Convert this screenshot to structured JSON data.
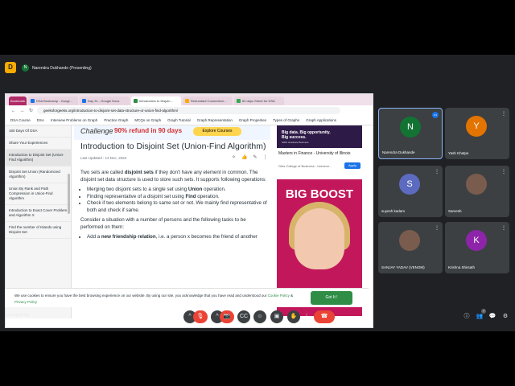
{
  "meet": {
    "presenter_initial": "N",
    "presenter_label": "Narendra Dukhande (Presenting)",
    "meeting_code": "cos-qfrd-skj",
    "app_logo_text": "D"
  },
  "browser": {
    "tabs": [
      {
        "label": "Bookmark",
        "bookmark": true
      },
      {
        "label": "DSA Bootcamp - Googl...",
        "fav": "#1a73e8"
      },
      {
        "label": "Day 31 - Google Docs",
        "fav": "#1a73e8"
      },
      {
        "label": "Introduction to Disjoin...",
        "fav": "#2f8d46",
        "active": true
      },
      {
        "label": "Redundant Connection...",
        "fav": "#f9ab00"
      },
      {
        "label": "60 days Sheet for DSA",
        "fav": "#34a853"
      }
    ],
    "url": "geeksforgeeks.org/introduction-to-disjoint-set-data-structure-or-union-find-algorithm/",
    "nav_items": [
      "DSA Course",
      "DSA",
      "Interview Problems on Graph",
      "Practice Graph",
      "MCQs on Graph",
      "Graph Tutorial",
      "Graph Representation",
      "Graph Properties",
      "Types of Graphs",
      "Graph Applications"
    ],
    "sidebar_items": [
      "160 Days Of DSA",
      "Share Your Experiences",
      "Introduction to Disjoint Set (Union-Find Algorithm)",
      "Disjoint Set Union (Randomized Algorithm)",
      "Union By Rank and Path Compression in Union-Find Algorithm",
      "Introduction to Exact Cover Problem and Algorithm X",
      "Find the number of Islands using Disjoint Set"
    ],
    "banner": {
      "left": "Challenge",
      "mid": "90% refund in 90 days",
      "cta": "Explore Courses"
    },
    "article": {
      "title": "Introduction to Disjoint Set (Union-Find Algorithm)",
      "meta": "Last Updated : 13 Dec, 2024",
      "p1_a": "Two sets are called ",
      "p1_b": "disjoint sets",
      "p1_c": " if they don't have any element in common. The disjoint set data structure is used to store such sets. It supports following operations:",
      "li1_a": "Merging two disjoint sets to a single set using ",
      "li1_b": "Union",
      "li1_c": " operation.",
      "li2_a": "Finding representative of a disjoint set using ",
      "li2_b": "Find",
      "li2_c": " operation.",
      "li3": "Check if two elements belong to same set or not. We mainly find representative of both and check if same.",
      "p2": "Consider a situation with a number of persons and the following tasks to be performed on them:",
      "li4_a": "Add a ",
      "li4_b": "new friendship relation",
      "li4_c": ", i.e. a person x becomes the friend of another"
    },
    "ads": {
      "ad1_line1": "Big data. Big opportunity.",
      "ad1_line2": "Big success.",
      "ad1_sub": "GIES Graduate Business",
      "caption": "Masters in Finance - University of Illinois",
      "sponsor": "Gies College of Business - Universi...",
      "apply": "Apply",
      "ad2_text": "BIG BOOST"
    },
    "cookie": {
      "text": "We use cookies to ensure you have the best browsing experience on our website. By using our site, you acknowledge that you have read and understood our ",
      "link1": "Cookie Policy",
      "amp": " & ",
      "link2": "Privacy Policy",
      "button": "Got It !"
    }
  },
  "participants": [
    {
      "initial": "N",
      "name": "Narendra Dukhande",
      "color": "#137333",
      "speaking": true
    },
    {
      "initial": "Y",
      "name": "Yash Khatpe",
      "color": "#e37400"
    },
    {
      "initial": "S",
      "name": "suyesh kadam",
      "color": "#5c6bc0"
    },
    {
      "initial": "",
      "name": "Sarvesh",
      "color": "#3c4043",
      "photo": true
    },
    {
      "initial": "",
      "name": "SANJAY YADAV (VENOM)",
      "color": "#3c4043",
      "photo": true
    },
    {
      "initial": "K",
      "name": "Krishna Shirsath",
      "color": "#8e24aa"
    }
  ],
  "icons": {
    "more": "⋮",
    "mic_off": "🎙",
    "cam_off": "📷",
    "hangup": "☎",
    "chevron_up": "^",
    "emoji": "☺",
    "captions": "CC",
    "present": "▣",
    "hand": "✋",
    "info": "ⓘ",
    "people": "👥",
    "chat": "💬",
    "activities": "⚙",
    "people_count": "7"
  }
}
